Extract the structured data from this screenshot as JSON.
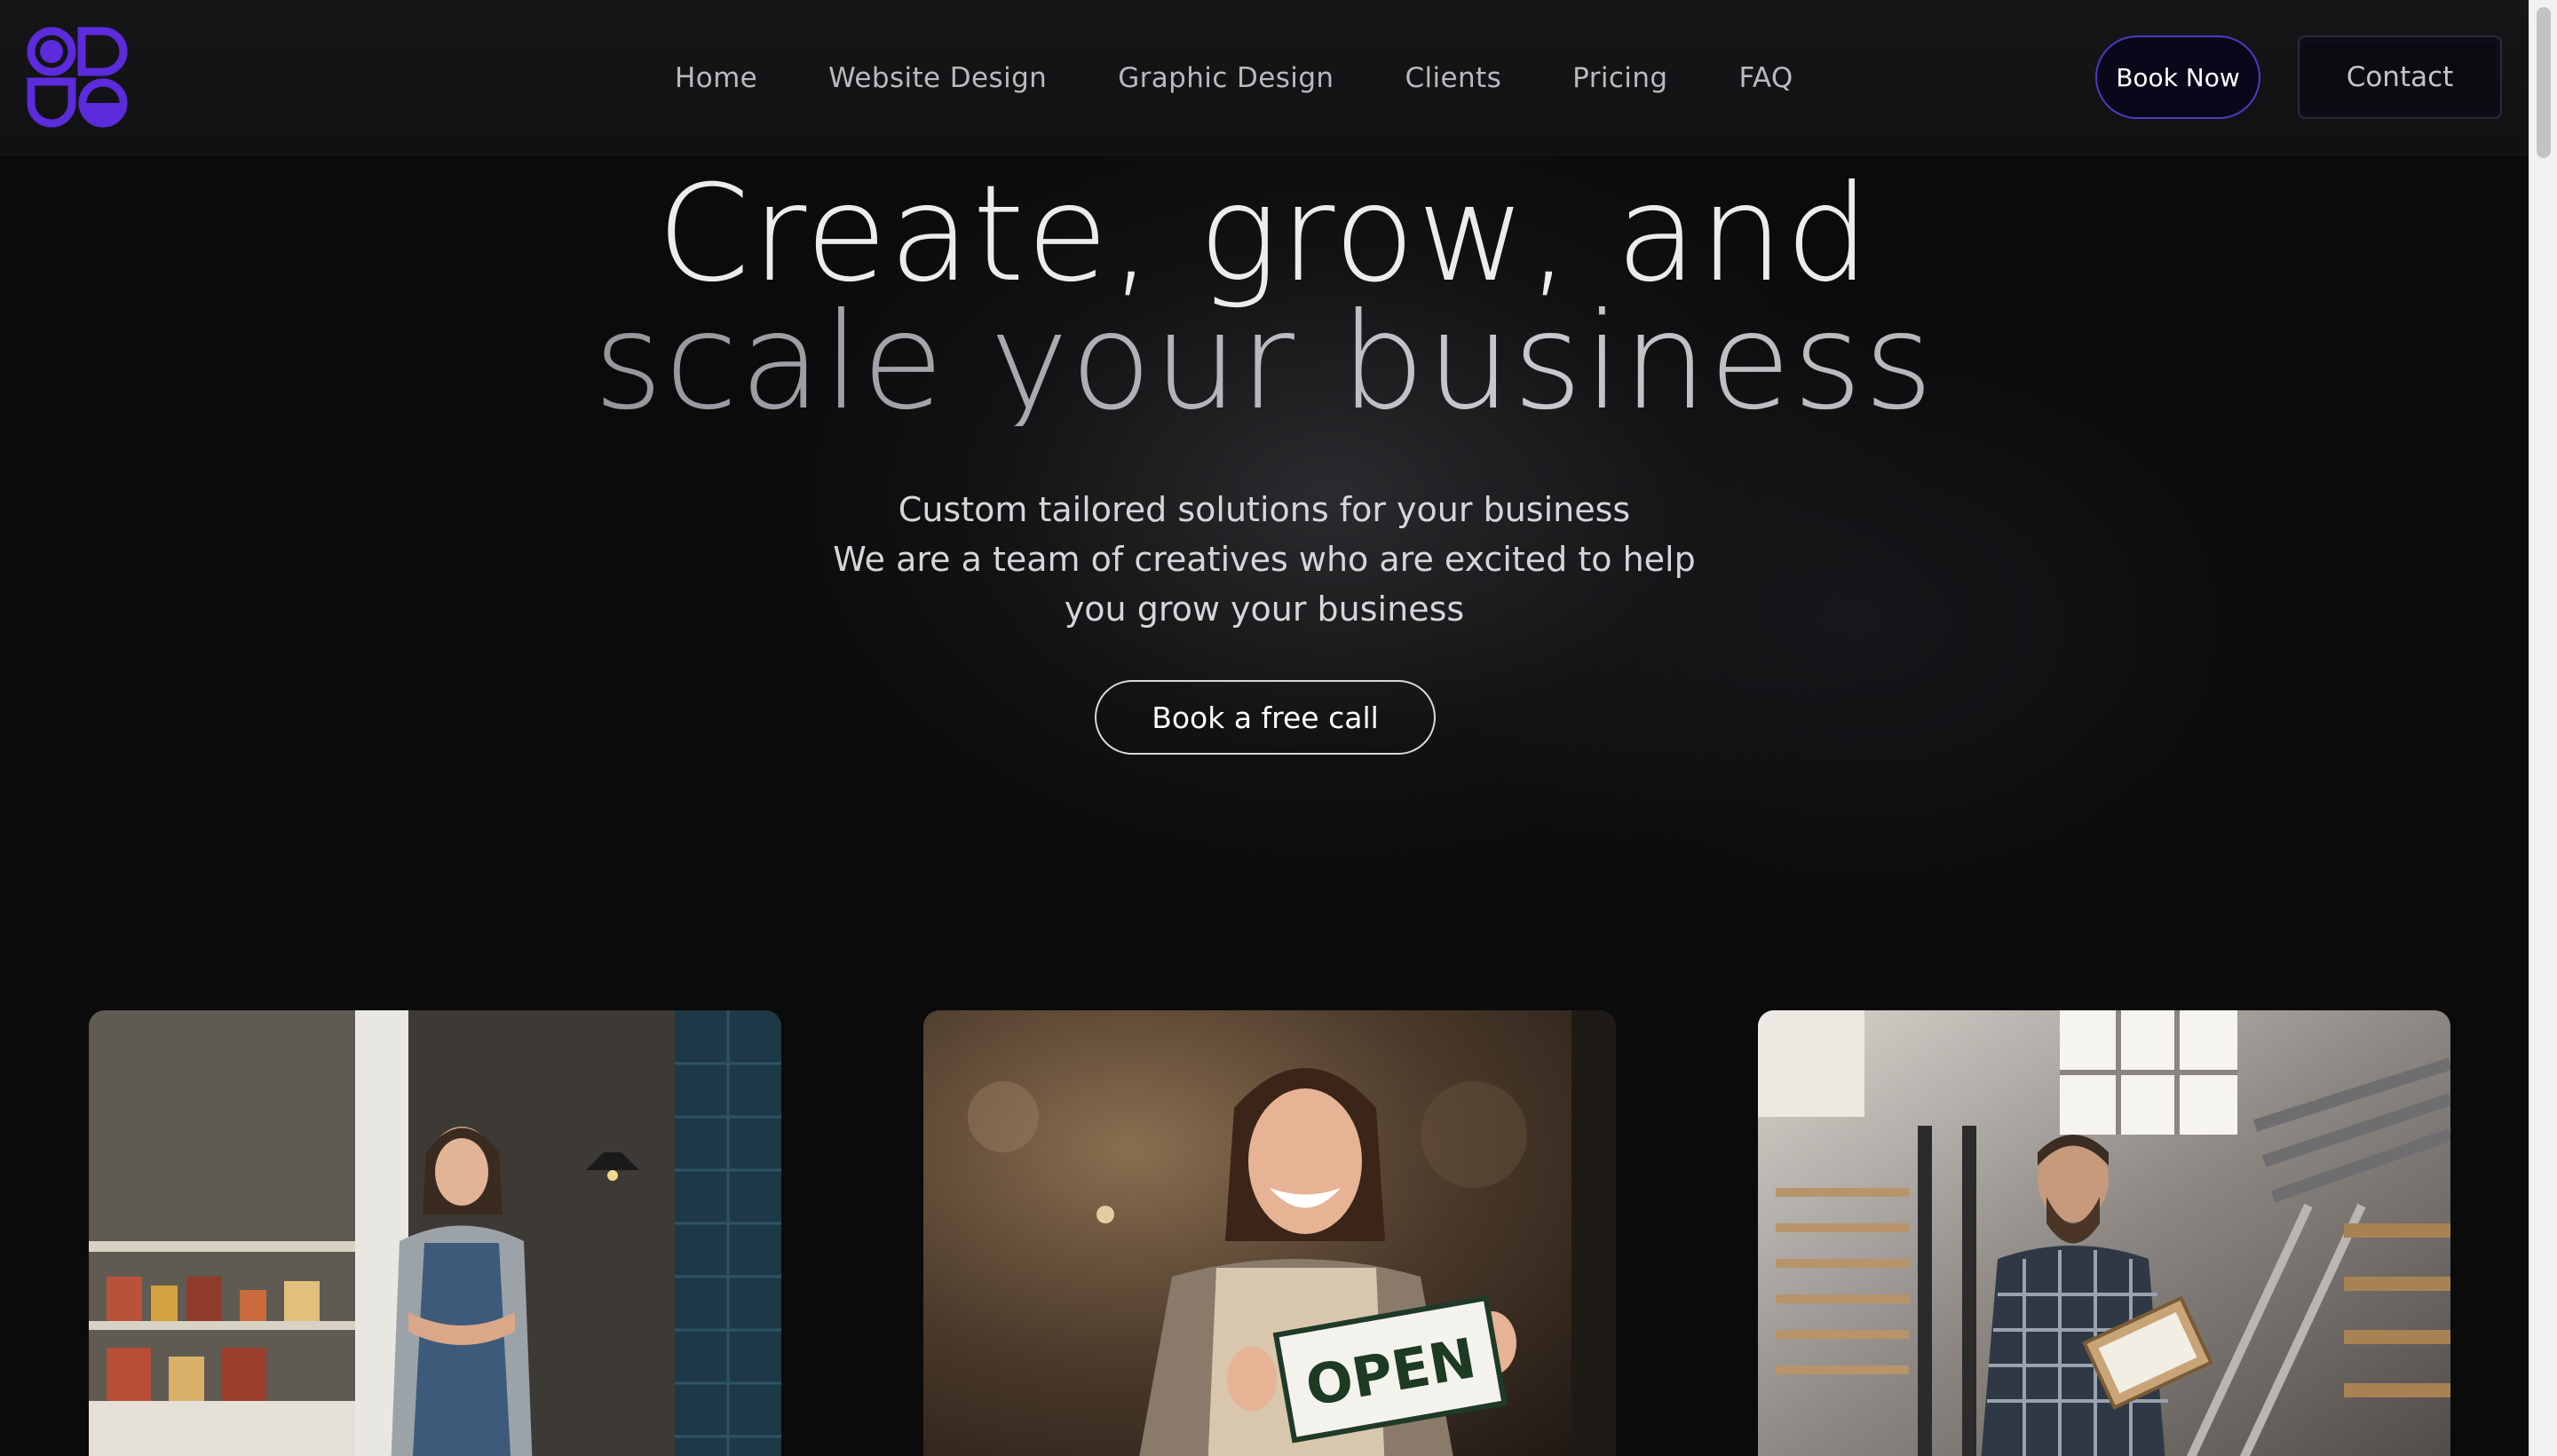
{
  "nav": {
    "logo_icon": "brand-logo-icon",
    "links": [
      {
        "label": "Home"
      },
      {
        "label": "Website Design"
      },
      {
        "label": "Graphic Design"
      },
      {
        "label": "Clients"
      },
      {
        "label": "Pricing"
      },
      {
        "label": "FAQ"
      }
    ],
    "book_label": "Book Now",
    "contact_label": "Contact"
  },
  "hero": {
    "title_line_1": "Create, grow, and",
    "title_line_2": "scale your business",
    "subtitle_lines": [
      "Custom tailored solutions for your business",
      "We are a team of creatives who are excited to help",
      "you grow your business"
    ],
    "cta_label": "Book a free call"
  },
  "cards": [
    {
      "photo": "shop-owner-in-doorway-photo"
    },
    {
      "photo": "woman-holding-open-sign-photo",
      "sign_text": "OPEN"
    },
    {
      "photo": "workshop-man-with-clipboard-photo"
    }
  ],
  "colors": {
    "brand_purple": "#5b2bdc",
    "background": "#0b0b0c",
    "book_border": "#4a3cc4"
  }
}
